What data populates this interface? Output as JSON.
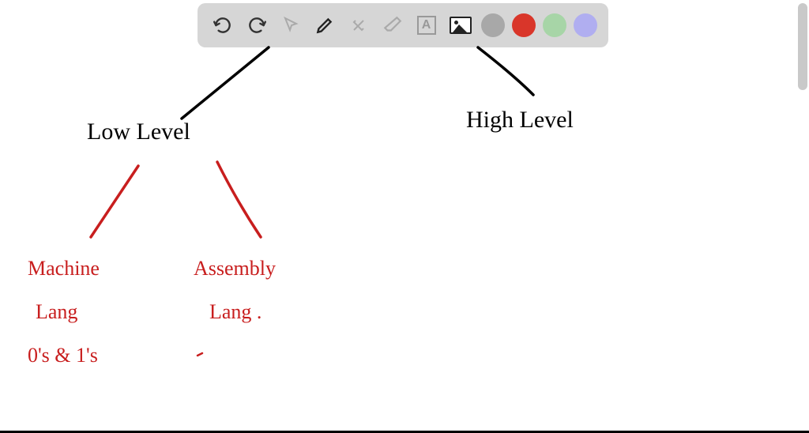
{
  "toolbar": {
    "tools": {
      "undo": "undo",
      "redo": "redo",
      "pointer": "pointer",
      "pen": "pen",
      "tools": "tools",
      "eraser": "eraser",
      "text": "A",
      "image": "image"
    },
    "colors": {
      "gray": "#a8a8a8",
      "red": "#d9362a",
      "green": "#a7d5a7",
      "purple": "#b0aef0"
    }
  },
  "diagram": {
    "node_low_level": "Low Level",
    "node_high_level": "High Level",
    "node_machine_lang_1": "Machine",
    "node_machine_lang_2": "Lang",
    "node_machine_lang_3": "0's & 1's",
    "node_assembly_lang_1": "Assembly",
    "node_assembly_lang_2": "Lang ."
  },
  "chart_data": {
    "type": "tree",
    "title": "",
    "nodes": [
      {
        "id": "root",
        "label": "",
        "color": "black"
      },
      {
        "id": "low",
        "label": "Low Level",
        "color": "black"
      },
      {
        "id": "high",
        "label": "High Level",
        "color": "black"
      },
      {
        "id": "machine",
        "label": "Machine Lang",
        "note": "0's & 1's",
        "color": "red"
      },
      {
        "id": "assembly",
        "label": "Assembly Lang.",
        "color": "red"
      }
    ],
    "edges": [
      {
        "from": "root",
        "to": "low",
        "color": "black"
      },
      {
        "from": "root",
        "to": "high",
        "color": "black"
      },
      {
        "from": "low",
        "to": "machine",
        "color": "red"
      },
      {
        "from": "low",
        "to": "assembly",
        "color": "red"
      }
    ]
  }
}
